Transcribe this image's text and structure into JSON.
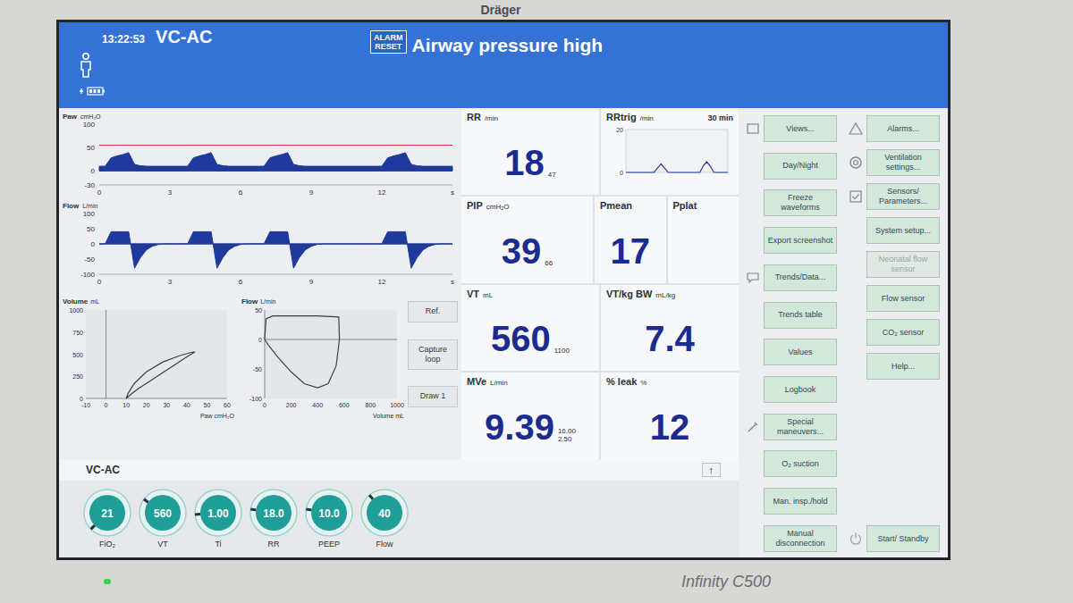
{
  "device": {
    "brand": "Dräger",
    "model": "Infinity C500"
  },
  "header": {
    "time": "13:22:53",
    "mode": "VC-AC",
    "alarm_reset": [
      "ALARM",
      "RESET"
    ],
    "alarm_message": "Airway pressure high"
  },
  "waveforms": [
    {
      "label": "Paw",
      "unit": "cmH₂O",
      "y_ticks": [
        "100",
        "50",
        "0",
        "-30"
      ],
      "x_ticks": [
        "0",
        "3",
        "6",
        "9",
        "12",
        "s"
      ],
      "alarm_limit": 55,
      "values": [
        10,
        10,
        28,
        32,
        35,
        39,
        14,
        11,
        10,
        10,
        10,
        10,
        10,
        10,
        10,
        10,
        28,
        32,
        35,
        39,
        14,
        11,
        10,
        10,
        10,
        10,
        10,
        10,
        10,
        28,
        32,
        35,
        39,
        14,
        11,
        10,
        10,
        10,
        10,
        10,
        10,
        10,
        10,
        10,
        10,
        10,
        10,
        10,
        10,
        28,
        32,
        35,
        39,
        14,
        11,
        10,
        10,
        10,
        10,
        10,
        10
      ]
    },
    {
      "label": "Flow",
      "unit": "L/min",
      "y_ticks": [
        "100",
        "50",
        "0",
        "-50",
        "-100"
      ],
      "x_ticks": [
        "0",
        "3",
        "6",
        "9",
        "12",
        "s"
      ],
      "values": [
        0,
        0,
        40,
        40,
        40,
        40,
        -80,
        -45,
        -20,
        -8,
        -2,
        0,
        0,
        0,
        0,
        0,
        40,
        40,
        40,
        40,
        -80,
        -45,
        -20,
        -8,
        -2,
        0,
        0,
        0,
        0,
        40,
        40,
        40,
        40,
        -80,
        -45,
        -20,
        -8,
        -2,
        0,
        0,
        0,
        0,
        0,
        0,
        0,
        0,
        0,
        0,
        0,
        40,
        40,
        40,
        40,
        -80,
        -45,
        -20,
        -8,
        -2,
        0,
        0,
        0
      ]
    }
  ],
  "loops": [
    {
      "y_label": "Volume",
      "y_unit": "mL",
      "y_ticks": [
        "1000",
        "750",
        "500",
        "250",
        "0"
      ],
      "x_ticks": [
        "-10",
        "0",
        "10",
        "20",
        "30",
        "40",
        "50",
        "60"
      ],
      "x_label": "Paw cmH₂O",
      "x": [
        10,
        12,
        16,
        22,
        28,
        34,
        40,
        44,
        42,
        36,
        28,
        20,
        14,
        11,
        10
      ],
      "y": [
        0,
        40,
        110,
        200,
        290,
        380,
        470,
        525,
        520,
        480,
        410,
        300,
        170,
        60,
        0
      ]
    },
    {
      "y_label": "Flow",
      "y_unit": "L/min",
      "y_ticks": [
        "50",
        "0",
        "-50",
        "-100"
      ],
      "x_ticks": [
        "0",
        "200",
        "400",
        "600",
        "800",
        "1000"
      ],
      "x_label": "Volume mL",
      "x": [
        0,
        10,
        60,
        200,
        400,
        560,
        565,
        540,
        480,
        400,
        300,
        200,
        100,
        30,
        0
      ],
      "y": [
        0,
        35,
        40,
        40,
        40,
        38,
        0,
        -45,
        -75,
        -82,
        -75,
        -55,
        -30,
        -10,
        0
      ]
    }
  ],
  "loop_buttons": [
    "Ref.",
    "Capture loop",
    "Draw 1"
  ],
  "parameters": [
    [
      {
        "kind": "value",
        "label": "RR",
        "unit": "/min",
        "value": "18",
        "limits": [
          "47"
        ]
      },
      {
        "kind": "trend",
        "label": "RRtrig",
        "unit": "/min",
        "span": "30 min",
        "y_ticks": [
          "20",
          "0"
        ],
        "values": [
          0,
          0,
          0,
          0,
          0,
          0,
          0,
          0,
          0,
          2,
          4,
          2,
          0,
          0,
          0,
          0,
          0,
          0,
          0,
          0,
          0,
          0,
          3,
          5,
          3,
          0,
          0,
          0,
          0,
          0
        ]
      }
    ],
    [
      {
        "kind": "value",
        "label": "PIP",
        "unit": "cmH₂O",
        "value": "39",
        "limits": [
          "66"
        ]
      },
      {
        "kind": "value",
        "label": "Pmean",
        "value": "17",
        "limits": []
      },
      {
        "kind": "value",
        "label": "Pplat",
        "limits": []
      }
    ],
    [
      {
        "kind": "value",
        "label": "VT",
        "unit": "mL",
        "value": "560",
        "limits": [
          "1100"
        ]
      },
      {
        "kind": "value",
        "label": "VT/kg BW",
        "unit": "mL/kg",
        "value": "7.4",
        "limits": []
      }
    ],
    [
      {
        "kind": "value",
        "label": "MVe",
        "unit": "L/min",
        "value": "9.39",
        "limits": [
          "16.00",
          "2.50"
        ]
      },
      {
        "kind": "value",
        "label": "% leak",
        "unit": "%",
        "value": "12",
        "limits": []
      }
    ]
  ],
  "settings": {
    "mode": "VC-AC",
    "expand": "↑",
    "knobs": [
      {
        "label": "FiO₂",
        "value": "21",
        "level": 0.0
      },
      {
        "label": "VT",
        "value": "560",
        "level": 0.3
      },
      {
        "label": "Ti",
        "value": "1.00",
        "level": 0.15
      },
      {
        "label": "RR",
        "value": "18.0",
        "level": 0.2
      },
      {
        "label": "PEEP",
        "value": "10.0",
        "level": 0.2
      },
      {
        "label": "Flow",
        "value": "40",
        "level": 0.35
      }
    ]
  },
  "menu": {
    "left": [
      {
        "label": "Views...",
        "disabled": false
      },
      {
        "label": "Day/Night",
        "disabled": false
      },
      {
        "label": "Freeze waveforms",
        "disabled": false
      },
      {
        "label": "Export screenshot",
        "disabled": false
      },
      {
        "label": "Trends/Data...",
        "disabled": false
      },
      {
        "label": "Trends table",
        "disabled": false
      },
      {
        "label": "Values",
        "disabled": false
      },
      {
        "label": "Logbook",
        "disabled": false
      },
      {
        "label": "Special maneuvers...",
        "disabled": false
      },
      {
        "label": "O₂ suction",
        "disabled": false
      },
      {
        "label": "Man. insp./hold",
        "disabled": false
      },
      {
        "label": "Manual disconnection",
        "disabled": false
      }
    ],
    "right": [
      {
        "label": "Alarms...",
        "disabled": false
      },
      {
        "label": "Ventilation settings...",
        "disabled": false
      },
      {
        "label": "Sensors/ Parameters...",
        "disabled": false
      },
      {
        "label": "System setup...",
        "disabled": false
      },
      {
        "label": "Neonatal flow sensor",
        "disabled": true
      },
      {
        "label": "Flow sensor",
        "disabled": false
      },
      {
        "label": "CO₂ sensor",
        "disabled": false
      },
      {
        "label": "Help...",
        "disabled": false
      }
    ],
    "standby": {
      "label": "Start/ Standby",
      "disabled": false
    }
  }
}
